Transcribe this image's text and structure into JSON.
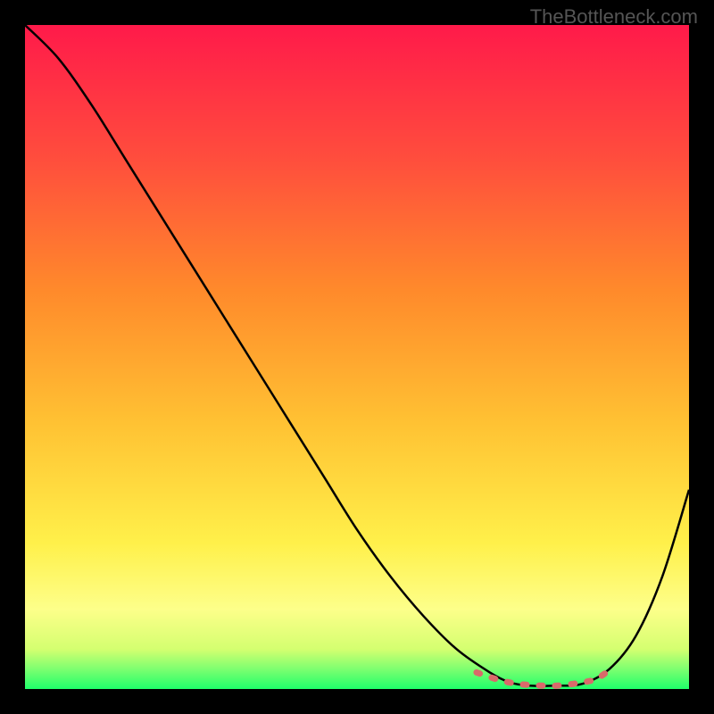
{
  "watermark": "TheBottleneck.com",
  "chart_data": {
    "type": "line",
    "title": "",
    "xlabel": "",
    "ylabel": "",
    "xlim": [
      0,
      100
    ],
    "ylim": [
      0,
      100
    ],
    "gradient_stops": [
      {
        "offset": 0,
        "color": "#ff1a4a"
      },
      {
        "offset": 20,
        "color": "#ff4d3d"
      },
      {
        "offset": 40,
        "color": "#ff8a2b"
      },
      {
        "offset": 60,
        "color": "#ffc233"
      },
      {
        "offset": 78,
        "color": "#fff04a"
      },
      {
        "offset": 88,
        "color": "#fdff8a"
      },
      {
        "offset": 94,
        "color": "#d4ff70"
      },
      {
        "offset": 97,
        "color": "#7dff70"
      },
      {
        "offset": 100,
        "color": "#1fff6a"
      }
    ],
    "series": [
      {
        "name": "bottleneck-curve",
        "stroke": "#000000",
        "x": [
          0,
          5,
          10,
          15,
          20,
          25,
          30,
          35,
          40,
          45,
          50,
          55,
          60,
          65,
          70,
          73,
          76,
          80,
          84,
          88,
          92,
          96,
          100
        ],
        "values": [
          100,
          95,
          88,
          80,
          72,
          64,
          56,
          48,
          40,
          32,
          24,
          17,
          11,
          6,
          2.5,
          1,
          0.5,
          0.5,
          0.8,
          3,
          8,
          17,
          30
        ]
      },
      {
        "name": "optimal-marker",
        "type": "dashed",
        "stroke": "#d96a6a",
        "x": [
          68,
          70,
          72,
          74,
          76,
          78,
          80,
          82,
          84,
          86,
          88
        ],
        "values": [
          2.5,
          1.8,
          1.2,
          0.8,
          0.6,
          0.5,
          0.5,
          0.7,
          1.0,
          1.5,
          2.8
        ]
      }
    ]
  }
}
